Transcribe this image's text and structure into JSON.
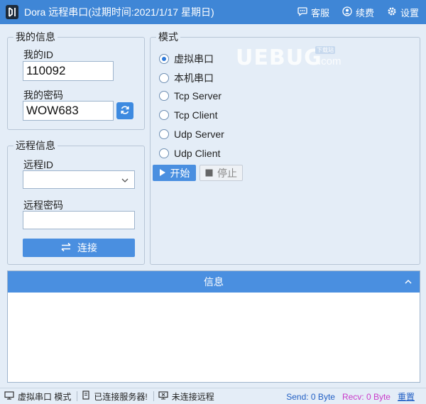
{
  "window": {
    "title": "Dora 远程串口(过期时间:2021/1/17 星期日)",
    "actions": {
      "service": "客服",
      "renew": "续费",
      "settings": "设置"
    }
  },
  "my_info": {
    "group_title": "我的信息",
    "id_label": "我的ID",
    "id_value": "110092",
    "password_label": "我的密码",
    "password_value": "WOW683"
  },
  "remote_info": {
    "group_title": "远程信息",
    "id_label": "远程ID",
    "id_value": "",
    "password_label": "远程密码",
    "password_value": "",
    "connect_label": "连接"
  },
  "mode": {
    "group_title": "模式",
    "selected_index": 0,
    "options": [
      "虚拟串口",
      "本机串口",
      "Tcp Server",
      "Tcp Client",
      "Udp Server",
      "Udp Client"
    ],
    "start_label": "开始",
    "stop_label": "停止"
  },
  "watermark": {
    "main": "UEBUG",
    "sub": ".com",
    "badge": "下载站"
  },
  "info_panel": {
    "header": "信息"
  },
  "statusbar": {
    "mode_status": "虚拟串口 模式",
    "server_status": "已连接服务器!",
    "remote_status": "未连接远程",
    "send": "Send: 0 Byte",
    "recv": "Recv: 0 Byte",
    "reset": "重置"
  },
  "colors": {
    "accent": "#4a8fe0",
    "titlebar": "#3f86d6",
    "background": "#e4edf7",
    "recv": "#c93bc9",
    "send": "#2360c4"
  }
}
